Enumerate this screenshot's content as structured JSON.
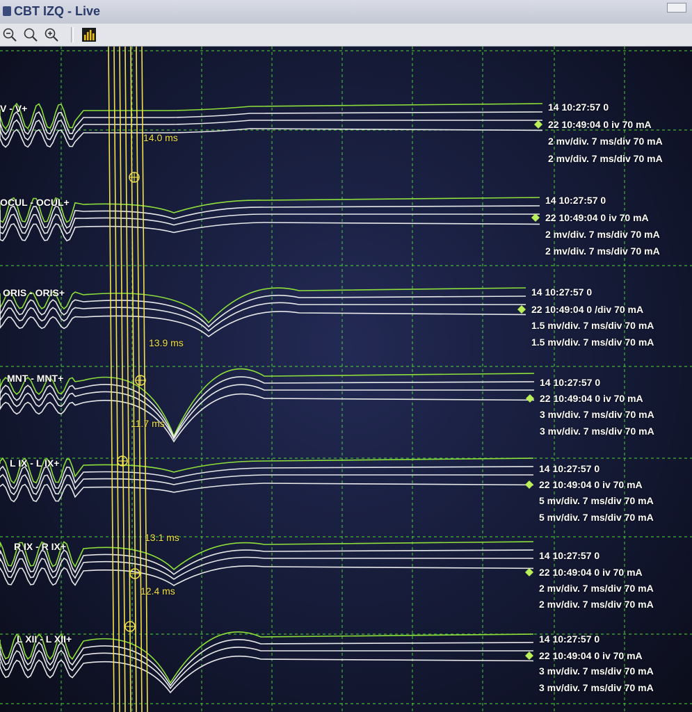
{
  "window": {
    "title": "CBT IZQ - Live"
  },
  "toolbar": [
    {
      "icon": "zoom-out-icon"
    },
    {
      "icon": "zoom-reset-icon"
    },
    {
      "icon": "zoom-in-icon"
    },
    {
      "icon": "bar-chart-icon"
    }
  ],
  "colors": {
    "grid": "#4cd137",
    "trace_green": "#8de03a",
    "trace_white": "#e8e8e8",
    "cursor": "#f2e14a",
    "background": "#151a36"
  },
  "channels": [
    {
      "label": "V - V+",
      "latency": "14.0 ms",
      "lines": [
        "14 10:27:57  0",
        "22 10:49:04  0 iv 70 mA",
        "2 mv/div. 7 ms/div 70 mA",
        "2 mv/div. 7 ms/div 70 mA"
      ]
    },
    {
      "label": "OCUL - OCUL+",
      "latency": "",
      "lines": [
        "14 10:27:57  0",
        "22 10:49:04  0 iv 70 mA",
        "2 mv/div. 7 ms/div 70 mA",
        "2 mv/div. 7 ms/div 70 mA"
      ]
    },
    {
      "label": "ORIS - ORIS+",
      "latency": "13.9 ms",
      "lines": [
        "14 10:27:57  0",
        "22 10:49:04  0 /div 70 mA",
        "1.5 mv/div. 7 ms/div 70 mA",
        "1.5 mv/div. 7 ms/div 70 mA"
      ]
    },
    {
      "label": "MNT - MNT+",
      "latency": "11.7 ms",
      "lines": [
        "14 10:27:57  0",
        "22 10:49:04  0 iv 70 mA",
        "3 mv/div. 7 ms/div 70 mA",
        "3 mv/div. 7 ms/div 70 mA"
      ]
    },
    {
      "label": "L IX - L IX+",
      "latency": "13.1 ms",
      "lines": [
        "14 10:27:57  0",
        "22 10:49:04  0 iv 70 mA",
        "5 mv/div. 7 ms/div 70 mA",
        "5 mv/div. 7 ms/div 70 mA"
      ]
    },
    {
      "label": "R IX - R IX+",
      "latency": "12.4 ms",
      "lines": [
        "14 10:27:57  0",
        "22 10:49:04  0 iv 70 mA",
        "2 mv/div. 7 ms/div 70 mA",
        "2 mv/div. 7 ms/div 70 mA"
      ]
    },
    {
      "label": "L XII - L XII+",
      "latency": "",
      "lines": [
        "14 10:27:57  0",
        "22 10:49:04  0 iv 70 mA",
        "3 mv/div. 7 ms/div 70 mA",
        "3 mv/div. 7 ms/div 70 mA"
      ]
    }
  ]
}
